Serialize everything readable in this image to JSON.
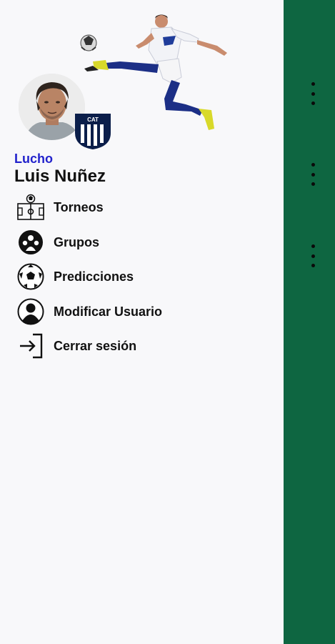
{
  "user": {
    "nickname": "Lucho",
    "full_name": "Luis Nuñez"
  },
  "menu": {
    "items": [
      {
        "label": "Torneos",
        "icon": "soccer-field-icon"
      },
      {
        "label": "Grupos",
        "icon": "group-icon"
      },
      {
        "label": "Predicciones",
        "icon": "soccer-ball-icon"
      },
      {
        "label": "Modificar Usuario",
        "icon": "user-icon"
      },
      {
        "label": "Cerrar sesión",
        "icon": "logout-icon"
      }
    ]
  },
  "colors": {
    "scrim": "#0e6641",
    "nickname": "#2222cc",
    "drawer_bg": "#f8f8fa"
  }
}
